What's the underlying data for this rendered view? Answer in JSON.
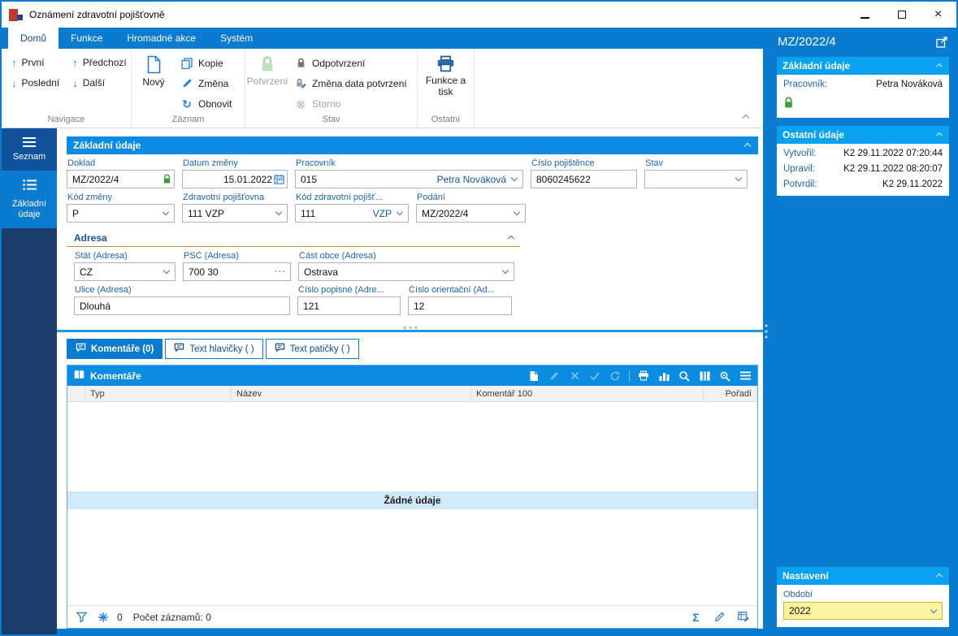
{
  "window": {
    "title": "Oznámení zdravotní pojišťovně"
  },
  "colors": {
    "accent": "#0b7bd0",
    "accent_bright": "#09a1f0",
    "section_header": "#0b8ce2",
    "sidebar_bg": "#1d3d6b",
    "label_blue": "#2066ae",
    "gold_underline": "#b4952f",
    "yellow_bg": "#fcf3a0",
    "yellow_border": "#c9b42b",
    "green_lock": "#3b9c3b",
    "empty_band": "#cfe9f8"
  },
  "icons": {
    "close": "×",
    "up_arrow": "↑",
    "down_arrow": "↓",
    "refresh": "↻",
    "storno": "⊗",
    "sigma": "Σ",
    "ellipsis": "···"
  },
  "ribbon": {
    "tabs": [
      {
        "label": "Domů",
        "active": true
      },
      {
        "label": "Funkce",
        "active": false
      },
      {
        "label": "Hromadné akce",
        "active": false
      },
      {
        "label": "Systém",
        "active": false
      }
    ],
    "navigace": {
      "label": "Navigace",
      "prvni": "První",
      "predchozi": "Předchozí",
      "posledni": "Poslední",
      "dalsi": "Další"
    },
    "zaznam": {
      "label": "Záznam",
      "novy": "Nový",
      "kopie": "Kopie",
      "zmena": "Změna",
      "obnovit": "Obnovit"
    },
    "stav": {
      "label": "Stav",
      "potvrzeni": "Potvrzení",
      "odpotvrzeni": "Odpotvrzení",
      "zmena_data": "Změna data potvrzení",
      "storno": "Storno"
    },
    "ostatni": {
      "label": "Ostatní",
      "funkce_tisk": "Funkce a tisk"
    }
  },
  "sidebar": {
    "items": [
      {
        "label": "Seznam"
      },
      {
        "label": "Základní údaje"
      }
    ]
  },
  "form": {
    "section_title": "Základní údaje",
    "doklad": {
      "label": "Doklad",
      "value": "MZ/2022/4"
    },
    "datum_zmeny": {
      "label": "Datum změny",
      "value": "15.01.2022"
    },
    "pracovnik": {
      "label": "Pracovník",
      "code": "015",
      "name": "Petra Nováková"
    },
    "cislo_pojistence": {
      "label": "Číslo pojištěnce",
      "value": "8060245622"
    },
    "stav": {
      "label": "Stav",
      "value": ""
    },
    "kod_zmeny": {
      "label": "Kód změny",
      "value": "P"
    },
    "zdravotni_pojistovna": {
      "label": "Zdravotní pojišťovna",
      "value": "111 VZP"
    },
    "kod_zdravotni_pojistovny": {
      "label": "Kód zdravotní pojišť...",
      "value": "111",
      "suffix": "VZP"
    },
    "podani": {
      "label": "Podání",
      "value": "MZ/2022/4"
    },
    "adresa": {
      "title": "Adresa",
      "stat": {
        "label": "Stát (Adresa)",
        "value": "CZ"
      },
      "psc": {
        "label": "PSČ (Adresa)",
        "value": "700 30"
      },
      "cast_obce": {
        "label": "Část obce (Adresa)",
        "value": "Ostrava"
      },
      "ulice": {
        "label": "Ulice (Adresa)",
        "value": "Dlouhá"
      },
      "cislo_popisne": {
        "label": "Číslo popisné (Adre...",
        "value": "121"
      },
      "cislo_orientacni": {
        "label": "Číslo orientační (Ad...",
        "value": "12"
      }
    }
  },
  "detail_tabs": [
    {
      "label": "Komentáře (0)",
      "active": true
    },
    {
      "label": "Text hlavičky ( )",
      "active": false
    },
    {
      "label": "Text patičky ( )",
      "active": false
    }
  ],
  "grid": {
    "title": "Komentáře",
    "columns": [
      "Typ",
      "Název",
      "Komentář 100",
      "Pořadí"
    ],
    "rows": [],
    "empty_text": "Žádné údaje",
    "footer": {
      "filter_count": "0",
      "records": "Počet záznamů: 0"
    }
  },
  "preview": {
    "doc_title": "MZ/2022/4",
    "zakladni": {
      "title": "Základní údaje",
      "rows": [
        {
          "label": "Pracovník:",
          "value": "Petra Nováková"
        }
      ]
    },
    "ostatni": {
      "title": "Ostatní údaje",
      "rows": [
        {
          "label": "Vytvořil:",
          "value": "K2 29.11.2022 07:20:44"
        },
        {
          "label": "Upravil:",
          "value": "K2 29.11.2022 08:20:07"
        },
        {
          "label": "Potvrdil:",
          "value": "K2 29.11.2022"
        }
      ]
    },
    "nastaveni": {
      "title": "Nastavení",
      "obdobi": {
        "label": "Období",
        "value": "2022"
      }
    }
  }
}
